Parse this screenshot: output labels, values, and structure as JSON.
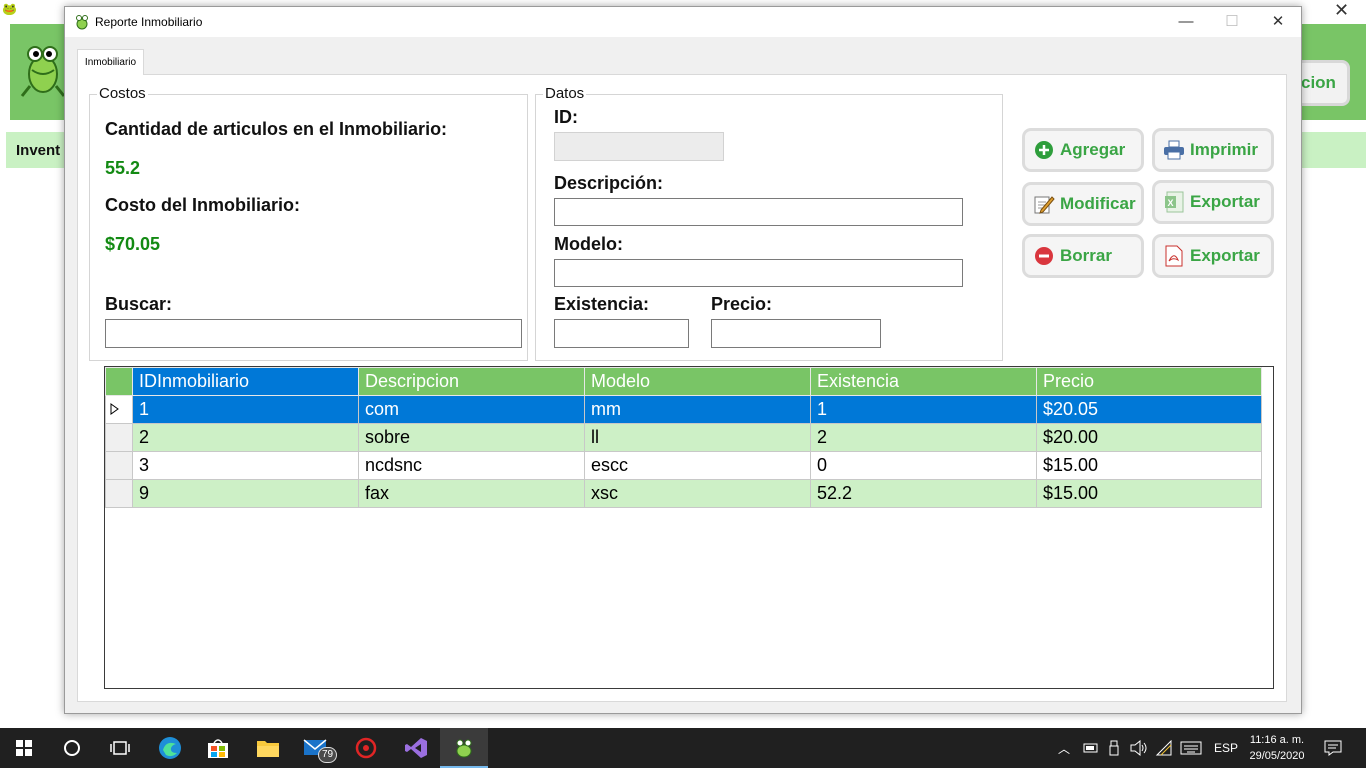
{
  "background_app": {
    "section_label": "Invent",
    "header_button": "cion"
  },
  "window": {
    "title": "Reporte Inmobiliario",
    "controls": {
      "minimize": "—",
      "maximize": "☐",
      "close": "✕"
    },
    "tab": "Inmobiliario"
  },
  "costos": {
    "group_title": "Costos",
    "cantidad_label": "Cantidad de articulos en el Inmobiliario:",
    "cantidad_value": "55.2",
    "costo_label": "Costo del Inmobiliario:",
    "costo_value": "$70.05",
    "buscar_label": "Buscar:",
    "buscar_value": ""
  },
  "datos": {
    "group_title": "Datos",
    "id_label": "ID:",
    "id_value": "",
    "descripcion_label": "Descripción:",
    "descripcion_value": "",
    "modelo_label": "Modelo:",
    "modelo_value": "",
    "existencia_label": "Existencia:",
    "existencia_value": "",
    "precio_label": "Precio:",
    "precio_value": ""
  },
  "actions": {
    "agregar": "Agregar",
    "imprimir": "Imprimir",
    "modificar": "Modificar",
    "exportar_excel": "Exportar",
    "borrar": "Borrar",
    "exportar_pdf": "Exportar"
  },
  "grid": {
    "columns": [
      "IDInmobiliario",
      "Descripcion",
      "Modelo",
      "Existencia",
      "Precio"
    ],
    "rows": [
      [
        "1",
        "com",
        "mm",
        "1",
        "$20.05"
      ],
      [
        "2",
        "sobre",
        "ll",
        "2",
        "$20.00"
      ],
      [
        "3",
        "ncdsnc",
        "escc",
        "0",
        "$15.00"
      ],
      [
        "9",
        "fax",
        "xsc",
        "52.2",
        "$15.00"
      ]
    ],
    "selected_row": 0
  },
  "taskbar": {
    "mail_badge": "79",
    "language": "ESP",
    "time": "11:16 a. m.",
    "date": "29/05/2020"
  },
  "colors": {
    "accent_green": "#79c566",
    "value_green": "#138a13",
    "selection_blue": "#0078d7",
    "alt_row_green": "#cdf0c6"
  }
}
